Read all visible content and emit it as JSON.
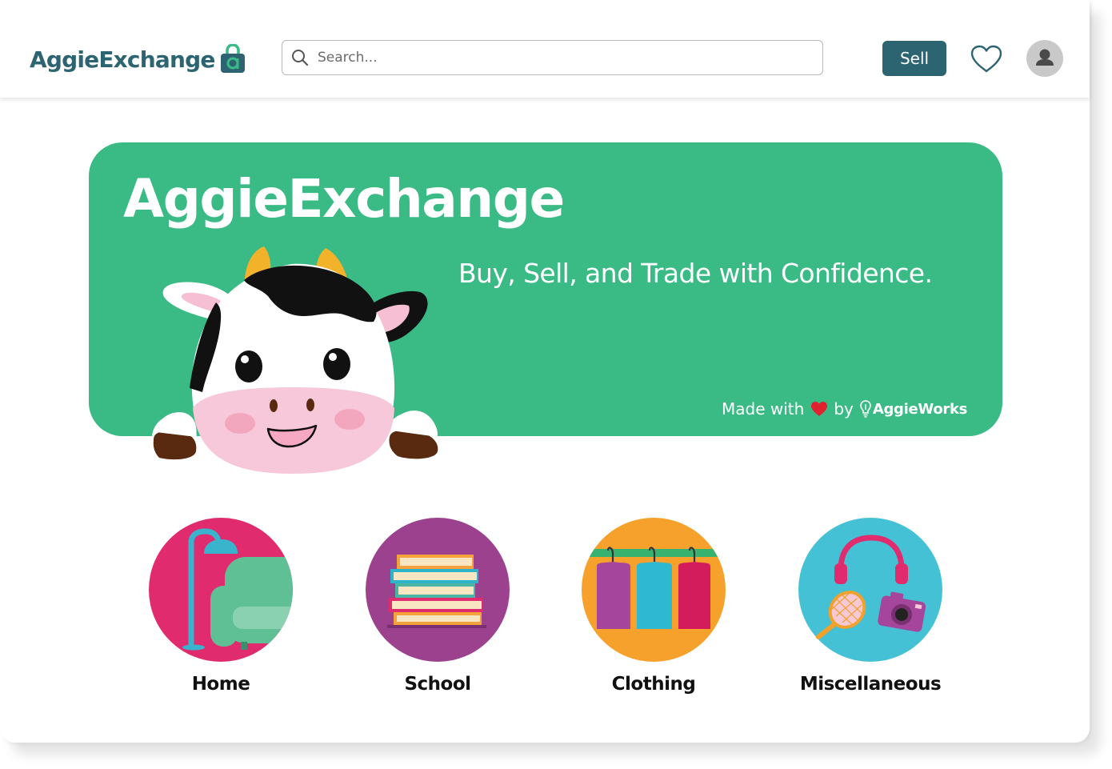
{
  "header": {
    "brand": "AggieExchange",
    "search_placeholder": "Search...",
    "sell_label": "Sell"
  },
  "hero": {
    "title": "AggieExchange",
    "tagline": "Buy, Sell, and Trade with Confidence.",
    "credit_prefix": "Made with",
    "credit_by": "by",
    "credit_brand": "AggieWorks"
  },
  "categories": [
    {
      "label": "Home",
      "color": "#e02c6e"
    },
    {
      "label": "School",
      "color": "#9b418e"
    },
    {
      "label": "Clothing",
      "color": "#f6a12c"
    },
    {
      "label": "Miscellaneous",
      "color": "#45c1d5"
    }
  ],
  "colors": {
    "brand": "#2c6471",
    "hero": "#3aba85",
    "background": "#ffffff"
  },
  "icons": [
    "search-icon",
    "heart-icon",
    "user-avatar-icon",
    "shopping-bag-icon"
  ]
}
